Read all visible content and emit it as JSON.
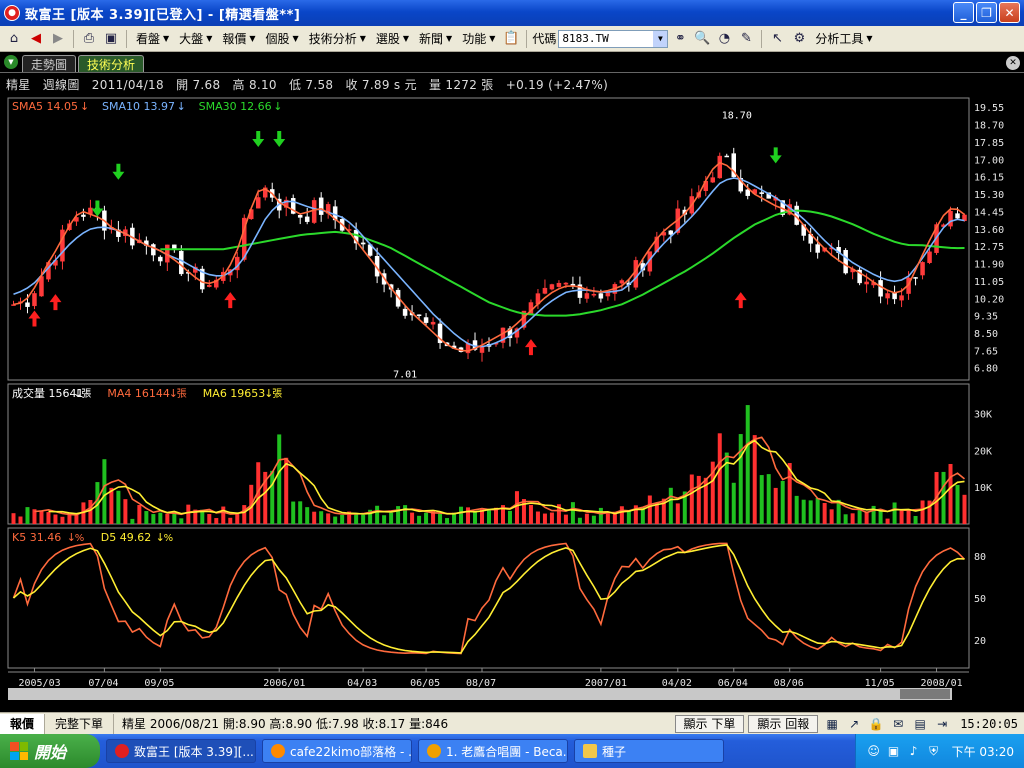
{
  "window": {
    "title": "致富王 [版本 3.39][已登入] - [精選看盤**]",
    "icon": "app-icon"
  },
  "toolbar": {
    "menus": [
      "看盤",
      "大盤",
      "報價",
      "個股",
      "技術分析",
      "選股",
      "新聞",
      "功能"
    ],
    "code_label": "代碼",
    "code_value": "8183.TW",
    "tools_label": "分析工具"
  },
  "tabs": {
    "items": [
      "走勢圖",
      "技術分析"
    ],
    "active": 1
  },
  "info": {
    "name": "精星",
    "period": "週線圖",
    "date": "2011/04/18",
    "open": "開 7.68",
    "high": "高 8.10",
    "low": "低 7.58",
    "close": "收 7.89 s 元",
    "volume": "量 1272 張",
    "change": "+0.19 (+2.47%)"
  },
  "chart_data": [
    {
      "type": "candlestick",
      "panel": "price",
      "legend": [
        {
          "label": "SMA5 14.05",
          "color": "#ff6a3d"
        },
        {
          "label": "SMA10 13.97",
          "color": "#7ab4ff"
        },
        {
          "label": "SMA30 12.66",
          "color": "#2bd92b"
        }
      ],
      "y_ticks": [
        "19.55",
        "18.70",
        "17.85",
        "17.00",
        "16.15",
        "15.30",
        "14.45",
        "13.60",
        "12.75",
        "11.90",
        "11.05",
        "10.20",
        "9.35",
        "8.50",
        "7.65",
        "6.80"
      ],
      "ylim": [
        6.2,
        20.0
      ],
      "annotations": [
        {
          "text": "18.70",
          "x": 106,
          "y": 18.7
        },
        {
          "text": "7.01",
          "x": 58,
          "y": 7.01
        }
      ],
      "sma5": [
        9.9,
        10.0,
        10.8,
        11.8,
        12.7,
        13.7,
        14.5,
        14.3,
        14.1,
        13.6,
        13.4,
        13.1,
        12.8,
        12.6,
        12.3,
        11.9,
        11.4,
        11.0,
        10.9,
        11.3,
        12.2,
        13.8,
        15.4,
        15.6,
        14.9,
        14.6,
        14.3,
        14.5,
        14.6,
        14.1,
        13.7,
        13.0,
        12.3,
        11.6,
        10.8,
        10.1,
        9.5,
        9.0,
        8.5,
        8.0,
        7.7,
        7.6,
        7.8,
        8.1,
        8.4,
        8.7,
        9.2,
        9.7,
        10.2,
        10.6,
        10.8,
        10.8,
        10.6,
        10.5,
        10.6,
        10.8,
        11.3,
        12.2,
        13.0,
        13.6,
        14.0,
        14.5,
        15.3,
        16.4,
        16.9,
        16.5,
        15.8,
        15.3,
        15.0,
        14.7,
        14.5,
        14.1,
        13.4,
        12.8,
        12.3,
        11.9,
        11.6,
        11.3,
        10.9,
        10.6,
        10.4,
        10.9,
        12.1,
        13.2,
        14.2,
        14.7,
        14.3
      ],
      "sma10": [
        10.4,
        10.6,
        11.0,
        11.6,
        12.2,
        12.8,
        13.3,
        13.6,
        13.7,
        13.6,
        13.4,
        13.1,
        12.8,
        12.6,
        12.3,
        12.1,
        11.8,
        11.5,
        11.3,
        11.3,
        11.6,
        12.3,
        13.3,
        14.3,
        14.8,
        15.0,
        14.8,
        14.6,
        14.5,
        14.3,
        14.1,
        13.6,
        13.0,
        12.4,
        11.8,
        11.2,
        10.6,
        10.0,
        9.4,
        8.9,
        8.4,
        8.0,
        7.8,
        7.9,
        8.1,
        8.4,
        8.8,
        9.3,
        9.8,
        10.2,
        10.5,
        10.6,
        10.6,
        10.5,
        10.5,
        10.6,
        11.0,
        11.7,
        12.4,
        13.0,
        13.5,
        14.0,
        14.6,
        15.3,
        15.9,
        16.1,
        16.0,
        15.7,
        15.4,
        15.1,
        14.7,
        14.3,
        13.8,
        13.2,
        12.7,
        12.3,
        11.9,
        11.6,
        11.3,
        11.1,
        11.0,
        11.3,
        12.0,
        12.8,
        13.6,
        14.1,
        14.0
      ],
      "sma30": [
        null,
        null,
        null,
        null,
        null,
        null,
        null,
        null,
        null,
        null,
        null,
        null,
        null,
        12.6,
        12.6,
        12.6,
        12.6,
        12.6,
        12.6,
        12.6,
        12.7,
        12.8,
        12.9,
        13.0,
        13.1,
        13.2,
        13.3,
        13.35,
        13.4,
        13.45,
        13.4,
        13.3,
        13.1,
        12.9,
        12.7,
        12.4,
        12.1,
        11.8,
        11.5,
        11.2,
        10.9,
        10.6,
        10.3,
        10.0,
        9.8,
        9.6,
        9.45,
        9.4,
        9.35,
        9.35,
        9.35,
        9.4,
        9.5,
        9.6,
        9.75,
        9.9,
        10.15,
        10.4,
        10.7,
        11.0,
        11.3,
        11.6,
        11.95,
        12.3,
        12.7,
        13.1,
        13.45,
        13.8,
        14.05,
        14.3,
        14.45,
        14.5,
        14.45,
        14.35,
        14.2,
        14.0,
        13.8,
        13.55,
        13.3,
        13.1,
        12.9,
        12.8,
        12.8,
        12.75,
        12.7,
        12.65,
        12.66
      ],
      "x_ticks": [
        {
          "i": 3,
          "label": "2005/03"
        },
        {
          "i": 13,
          "label": "07/04"
        },
        {
          "i": 21,
          "label": "09/05"
        },
        {
          "i": 38,
          "label": "2006/01"
        },
        {
          "i": 50,
          "label": "04/03"
        },
        {
          "i": 59,
          "label": "06/05"
        },
        {
          "i": 67,
          "label": "08/07"
        },
        {
          "i": 84,
          "label": "2007/01"
        },
        {
          "i": 95,
          "label": "04/02"
        },
        {
          "i": 103,
          "label": "06/04"
        },
        {
          "i": 111,
          "label": "08/06"
        },
        {
          "i": 124,
          "label": "11/05"
        },
        {
          "i": 132,
          "label": "2008/01"
        }
      ]
    },
    {
      "type": "bar",
      "panel": "volume",
      "legend": [
        {
          "label": "成交量 15641",
          "color": "#ffffff"
        },
        {
          "label": "MA4 16144",
          "color": "#ff6a3d"
        },
        {
          "label": "MA6 19653",
          "color": "#ffee33"
        }
      ],
      "unit": "張",
      "y_ticks": [
        "30K",
        "20K",
        "10K"
      ],
      "ylim": [
        0,
        38000
      ]
    },
    {
      "type": "line",
      "panel": "kd",
      "legend": [
        {
          "label": "K5 31.46",
          "color": "#ff6a3d"
        },
        {
          "label": "D5 49.62",
          "color": "#ffee33"
        }
      ],
      "unit": "%",
      "y_ticks": [
        "80",
        "50",
        "20"
      ],
      "ylim": [
        0,
        100
      ]
    }
  ],
  "bottom": {
    "tabs": [
      "報價",
      "完整下單"
    ],
    "quote": "精星 2006/08/21 開:8.90 高:8.90 低:7.98 收:8.17 量:846",
    "btn_show_order": "顯示 下單",
    "btn_show_report": "顯示 回報",
    "time": "15:20:05"
  },
  "taskbar": {
    "start": "開始",
    "tasks": [
      {
        "label": "致富王 [版本 3.39][...",
        "color": "#e02020"
      },
      {
        "label": "cafe22kimo部落格 - ...",
        "color": "#ff8a00"
      },
      {
        "label": "1. 老鷹合唱團 - Beca...",
        "color": "#f0a000"
      },
      {
        "label": "種子",
        "color": "#f2c84b"
      }
    ],
    "clock": "下午 03:20"
  }
}
